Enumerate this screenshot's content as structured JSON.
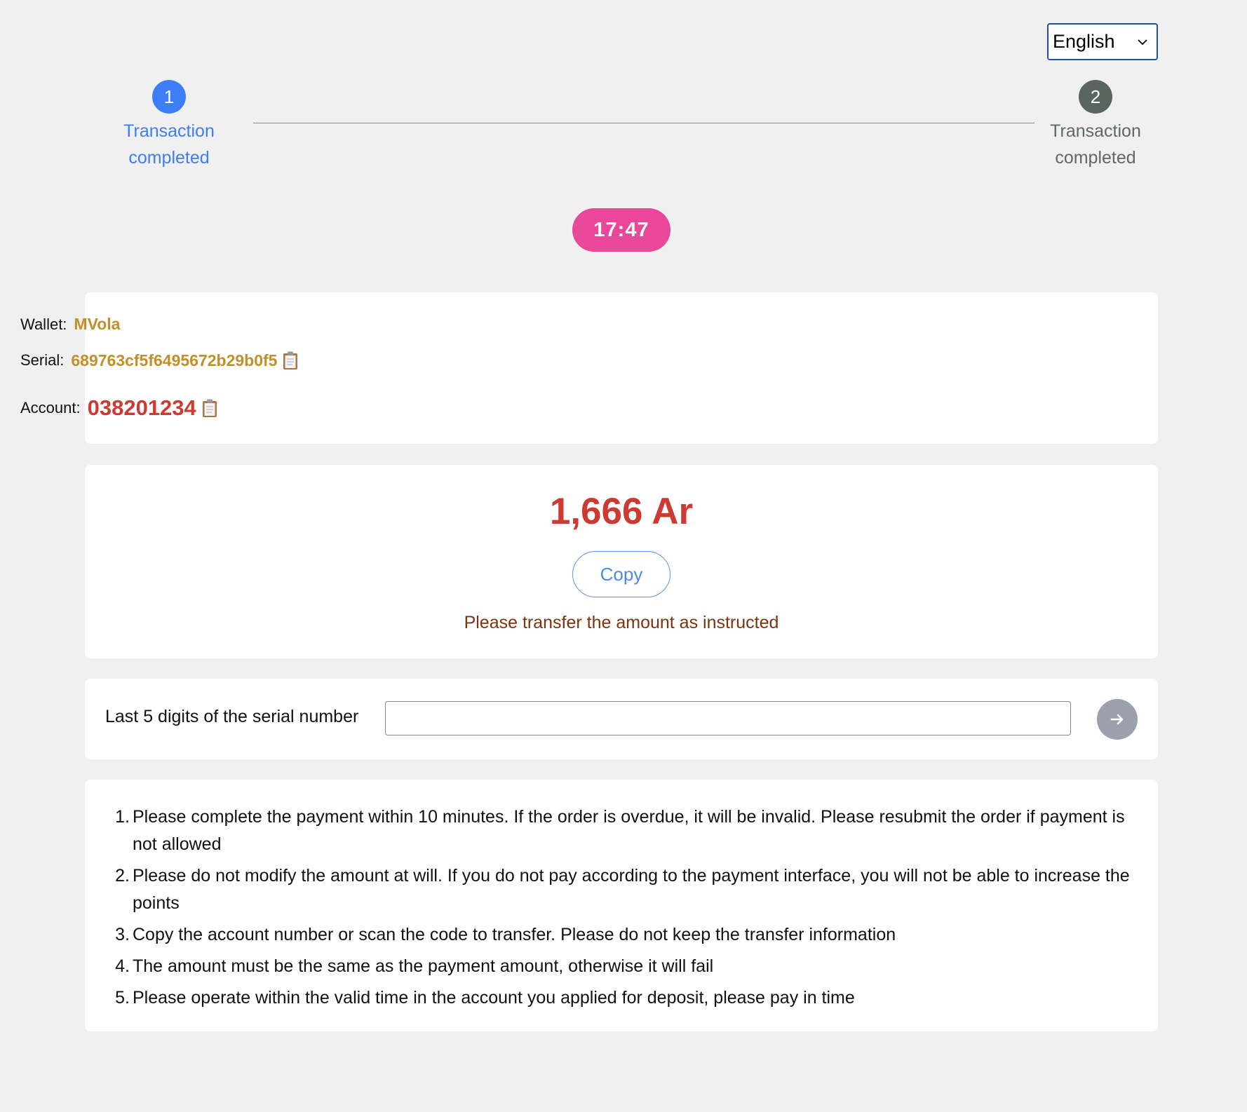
{
  "language": {
    "selected": "English"
  },
  "steps": [
    {
      "number": "1",
      "label": "Transaction completed",
      "state": "active",
      "color": "#3d7df5"
    },
    {
      "number": "2",
      "label": "Transaction completed",
      "state": "inactive",
      "color": "#5a6560"
    }
  ],
  "timer": {
    "value": "17:47",
    "color": "#e8479a"
  },
  "info": {
    "wallet_label": "Wallet:",
    "wallet_value": "MVola",
    "serial_label": "Serial:",
    "serial_value": "689763cf5f6495672b29b0f5",
    "account_label": "Account:",
    "account_value": "038201234",
    "copy_icon": "clipboard-icon"
  },
  "amount": {
    "value": "1,666 Ar",
    "copy_label": "Copy",
    "notice": "Please transfer the amount as instructed"
  },
  "serial_digits": {
    "label": "Last 5 digits of the serial number",
    "value": "",
    "placeholder": "",
    "submit_icon": "arrow-right-icon"
  },
  "rules": [
    "Please complete the payment within 10 minutes. If the order is overdue, it will be invalid. Please resubmit the order if payment is not allowed",
    "Please do not modify the amount at will. If you do not pay according to the payment interface, you will not be able to increase the points",
    "Copy the account number or scan the code to transfer. Please do not keep the transfer information",
    "The amount must be the same as the payment amount, otherwise it will fail",
    "Please operate within the valid time in the account you applied for deposit, please pay in time"
  ],
  "colors": {
    "background": "#f0f0f0",
    "accent_blue": "#3d7df5",
    "amount_red": "#cd3a32",
    "gold": "#c0902a"
  }
}
